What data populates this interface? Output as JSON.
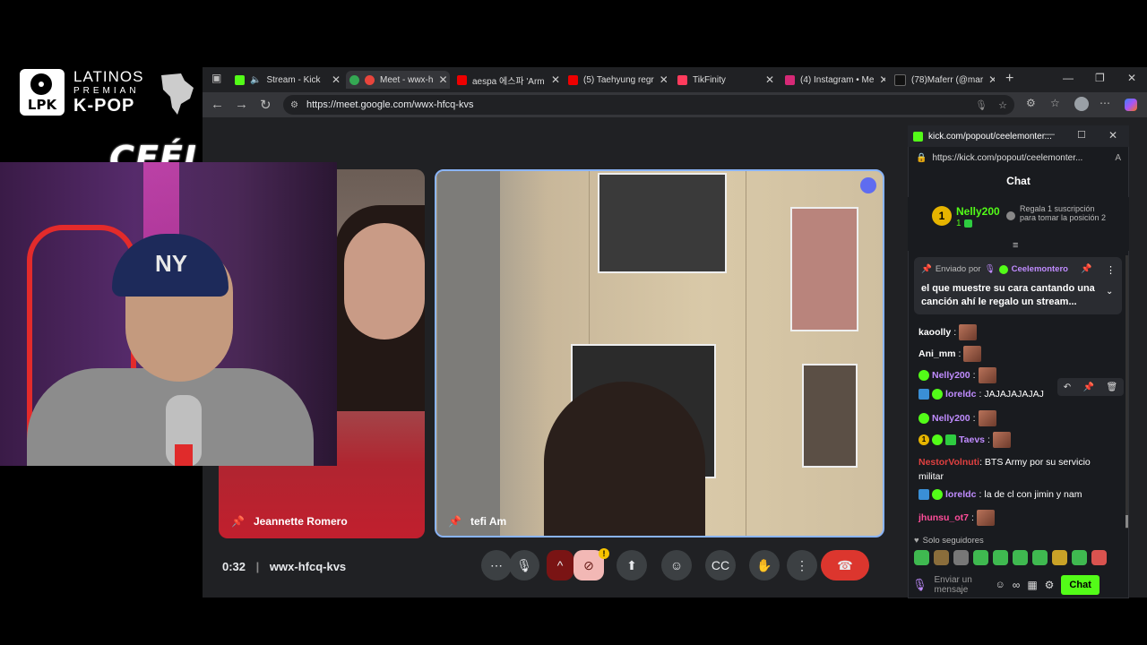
{
  "overlay": {
    "logo_letters": "LPK",
    "logo_line1": "LATINOS",
    "logo_line2": "PREMIAN",
    "logo_line3": "K-POP",
    "streamer_name": "CEÉLE"
  },
  "browser": {
    "tabs": [
      {
        "label": "Stream - Kick",
        "color": "#53fc18"
      },
      {
        "label": "Meet - wwx-h",
        "color": "#e8453c"
      },
      {
        "label": "aespa 에스파 'Arm",
        "color": "#e00"
      },
      {
        "label": "(5) Taehyung regr",
        "color": "#e00"
      },
      {
        "label": "TikFinity",
        "color": "#ff3b5c"
      },
      {
        "label": "(4) Instagram • Me",
        "color": "#d62976"
      },
      {
        "label": "(78)Maferr (@mar",
        "color": "#111"
      }
    ],
    "url": "https://meet.google.com/wwx-hfcq-kvs"
  },
  "meet": {
    "participant1": "Jeannette Romero",
    "participant2": "tefi Am",
    "timer": "0:32",
    "meeting_code": "wwx-hfcq-kvs"
  },
  "chat": {
    "window_title": "kick.com/popout/ceelemonter...",
    "url": "https://kick.com/popout/ceelemonter...",
    "header": "Chat",
    "top_gifter": "Nelly200",
    "top_gifter_count": "1",
    "gift_prompt": "Regala 1 suscripción para tomar la posición 2",
    "pinned_label": "Enviado por",
    "pinned_author": "Ceelemontero",
    "pinned_message": "el que muestre su cara cantando una canción ahí le regalo un stream...",
    "messages": [
      {
        "user": "kaoolly",
        "text": "",
        "color": "#ffffff"
      },
      {
        "user": "Ani_mm",
        "text": "",
        "color": "#ffffff"
      },
      {
        "user": "Nelly200",
        "text": "",
        "color": "#c08cff"
      },
      {
        "user": "loreldc",
        "text": "JAJAJAJAJAJ",
        "color": "#c08cff"
      },
      {
        "user": "Nelly200",
        "text": "",
        "color": "#c08cff"
      },
      {
        "user": "Taevs",
        "text": "",
        "color": "#c08cff"
      },
      {
        "user": "NestorVolnuti",
        "text": "BTS Army por su servicio militar",
        "color": "#e04040"
      },
      {
        "user": "loreldc",
        "text": "la de cl con jimin y nam",
        "color": "#c08cff"
      },
      {
        "user": "jhunsu_ot7",
        "text": "",
        "color": "#ff4d9a"
      }
    ],
    "followers_only": "Solo seguidores",
    "input_placeholder": "Enviar un mensaje",
    "send_label": "Chat"
  }
}
